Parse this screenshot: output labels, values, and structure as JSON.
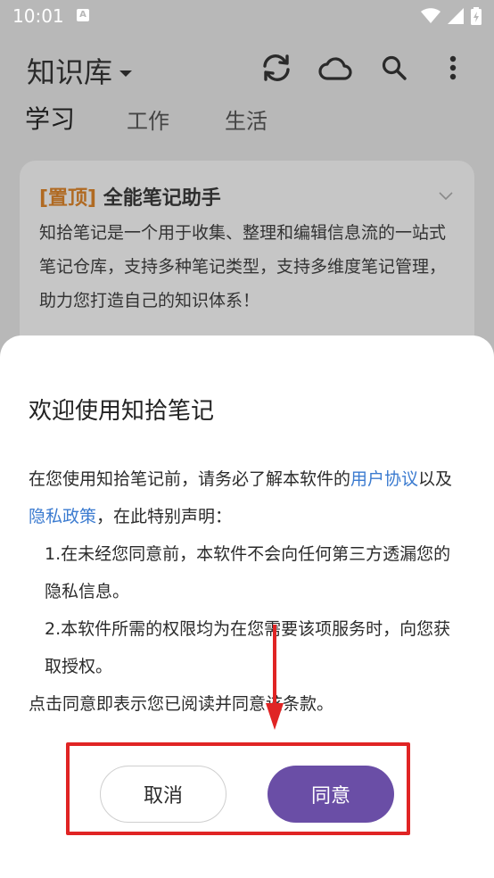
{
  "status_bar": {
    "time": "10:01",
    "notification_badge": "A"
  },
  "app_bar": {
    "title": "知识库",
    "icons": [
      "sync-icon",
      "cloud-icon",
      "search-icon",
      "more-vert-icon"
    ]
  },
  "tabs": [
    {
      "label": "学习",
      "active": true
    },
    {
      "label": "工作",
      "active": false
    },
    {
      "label": "生活",
      "active": false
    }
  ],
  "note_card": {
    "tag": "[置顶]",
    "title": "全能笔记助手",
    "body": "知拾笔记是一个用于收集、整理和编辑信息流的一站式笔记仓库，支持多种笔记类型，支持多维度笔记管理，助力您打造自己的知识体系！"
  },
  "dialog": {
    "title": "欢迎使用知拾笔记",
    "intro_prefix": "在您使用知拾笔记前，请务必了解本软件的",
    "link_user_agreement": "用户协议",
    "intro_mid": "以及",
    "link_privacy_policy": "隐私政策",
    "intro_suffix": "，在此特别声明：",
    "point1": "1.在未经您同意前，本软件不会向任何第三方透漏您的隐私信息。",
    "point2": "2.本软件所需的权限均为在您需要该项服务时，向您获取授权。",
    "closing": "点击同意即表示您已阅读并同意该条款。",
    "cancel_label": "取消",
    "agree_label": "同意"
  },
  "colors": {
    "accent": "#6a4ea6",
    "link": "#3b7bd0",
    "highlight": "#e02424",
    "tag": "#b06a22"
  }
}
